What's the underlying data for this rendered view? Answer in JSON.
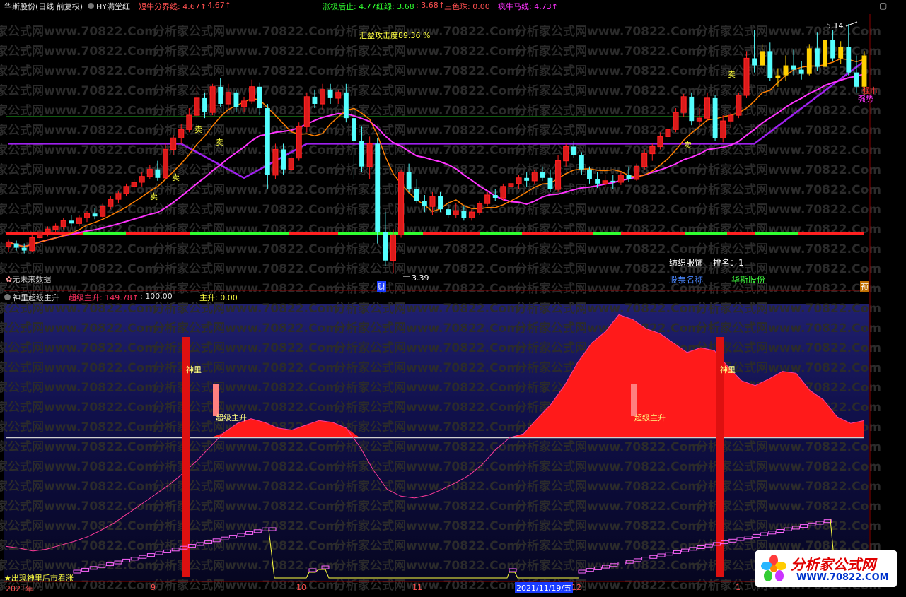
{
  "header": {
    "stock": "华斯股份",
    "period": "(日线 前复权)",
    "indicator": "HY满堂红",
    "bull_split": "短牛分界线: 4.67↑",
    "bull_split2": ": 4.67↑",
    "limit_stop": "涨极后止: 4.77",
    "red_green": "红绿: 3.68",
    "red_green2": ": 3.68↑",
    "three_color": "三色珠: 0.00",
    "crazy_bull": "疯牛马线: 4.73↑"
  },
  "annotations": {
    "attack": "汇盈攻击度89.36 %",
    "high": "5.14",
    "low": "3.39",
    "sell": "卖",
    "fin": "财",
    "pre": "预",
    "no_future": "无未来数据",
    "strong": "强市",
    "strong2": "强势"
  },
  "info_panel": {
    "industry": "纺织服饰",
    "rank": "排名：1",
    "name_label": "股票名称",
    "name_value": "华斯股份"
  },
  "sub_header": {
    "title": "神里超级主升",
    "super": "超级主升: 149.78↑",
    "fixed": ": 100.00",
    "main": "主升: 0.00"
  },
  "sub_annotations": {
    "shenli": "神里",
    "super_up": "超级主升",
    "hint": "★出现神里后市看涨"
  },
  "date_axis": {
    "year": "2021年",
    "m9": "9",
    "m10": "10",
    "m11": "11",
    "cursor": "2021/11/19/五",
    "m12": "12",
    "m1": "1"
  },
  "watermark": {
    "text1": "分析家公式网",
    "text2": "www.70822.Com",
    "logo_cn": "分析家公式网",
    "logo_en": "WWW.70822.COM"
  },
  "colors": {
    "up": "#ff2020",
    "down": "#54ffff",
    "ma_purple": "#a020f0",
    "ma_magenta": "#ff33ff",
    "ma_orange": "#ff7f00"
  },
  "chart_data": {
    "type": "candlestick",
    "ohlc": [
      [
        3.58,
        3.63,
        3.54,
        3.61
      ],
      [
        3.6,
        3.62,
        3.55,
        3.57
      ],
      [
        3.57,
        3.6,
        3.53,
        3.55
      ],
      [
        3.55,
        3.66,
        3.54,
        3.64
      ],
      [
        3.64,
        3.7,
        3.62,
        3.68
      ],
      [
        3.68,
        3.72,
        3.65,
        3.7
      ],
      [
        3.7,
        3.74,
        3.67,
        3.72
      ],
      [
        3.72,
        3.78,
        3.7,
        3.76
      ],
      [
        3.76,
        3.8,
        3.72,
        3.74
      ],
      [
        3.74,
        3.8,
        3.72,
        3.78
      ],
      [
        3.78,
        3.83,
        3.75,
        3.81
      ],
      [
        3.81,
        3.85,
        3.77,
        3.79
      ],
      [
        3.79,
        3.88,
        3.78,
        3.86
      ],
      [
        3.86,
        3.93,
        3.84,
        3.91
      ],
      [
        3.91,
        3.97,
        3.88,
        3.95
      ],
      [
        3.95,
        4.02,
        3.93,
        4.0
      ],
      [
        4.0,
        4.05,
        3.97,
        4.03
      ],
      [
        4.03,
        4.1,
        4.0,
        4.07
      ],
      [
        4.07,
        4.15,
        4.05,
        4.12
      ],
      [
        4.12,
        4.18,
        4.04,
        4.06
      ],
      [
        4.06,
        4.3,
        4.05,
        4.26
      ],
      [
        4.26,
        4.36,
        4.22,
        4.34
      ],
      [
        4.34,
        4.44,
        4.3,
        4.4
      ],
      [
        4.4,
        4.55,
        4.38,
        4.5
      ],
      [
        4.5,
        4.7,
        4.48,
        4.62
      ],
      [
        4.62,
        4.66,
        4.48,
        4.52
      ],
      [
        4.52,
        4.72,
        4.5,
        4.7
      ],
      [
        4.7,
        4.76,
        4.56,
        4.58
      ],
      [
        4.58,
        4.72,
        4.54,
        4.66
      ],
      [
        4.66,
        4.68,
        4.52,
        4.56
      ],
      [
        4.56,
        4.63,
        4.52,
        4.6
      ],
      [
        4.6,
        4.75,
        4.58,
        4.7
      ],
      [
        4.7,
        4.73,
        4.5,
        4.55
      ],
      [
        4.55,
        4.58,
        3.98,
        4.08
      ],
      [
        4.08,
        4.3,
        4.05,
        4.26
      ],
      [
        4.26,
        4.3,
        4.08,
        4.12
      ],
      [
        4.12,
        4.22,
        4.1,
        4.2
      ],
      [
        4.2,
        4.45,
        4.18,
        4.42
      ],
      [
        4.42,
        4.66,
        4.38,
        4.63
      ],
      [
        4.63,
        4.68,
        4.55,
        4.58
      ],
      [
        4.58,
        4.72,
        4.54,
        4.68
      ],
      [
        4.68,
        4.72,
        4.58,
        4.62
      ],
      [
        4.62,
        4.68,
        4.58,
        4.66
      ],
      [
        4.66,
        4.72,
        4.45,
        4.48
      ],
      [
        4.48,
        4.55,
        4.05,
        4.32
      ],
      [
        4.32,
        4.42,
        4.1,
        4.14
      ],
      [
        4.14,
        4.35,
        4.05,
        4.3
      ],
      [
        4.3,
        4.34,
        3.6,
        3.68
      ],
      [
        3.68,
        3.82,
        3.44,
        3.48
      ],
      [
        3.48,
        3.7,
        3.39,
        3.66
      ],
      [
        3.66,
        4.12,
        3.64,
        4.1
      ],
      [
        4.1,
        4.16,
        3.96,
        3.98
      ],
      [
        3.98,
        4.05,
        3.88,
        3.9
      ],
      [
        3.9,
        3.94,
        3.82,
        3.86
      ],
      [
        3.86,
        3.96,
        3.8,
        3.93
      ],
      [
        3.93,
        3.96,
        3.82,
        3.84
      ],
      [
        3.84,
        3.9,
        3.78,
        3.8
      ],
      [
        3.8,
        3.88,
        3.78,
        3.83
      ],
      [
        3.83,
        3.86,
        3.76,
        3.78
      ],
      [
        3.78,
        3.84,
        3.76,
        3.82
      ],
      [
        3.82,
        3.9,
        3.8,
        3.88
      ],
      [
        3.88,
        3.96,
        3.86,
        3.94
      ],
      [
        3.94,
        3.98,
        3.9,
        3.92
      ],
      [
        3.92,
        4.02,
        3.9,
        4.0
      ],
      [
        4.0,
        4.06,
        3.96,
        4.02
      ],
      [
        4.02,
        4.08,
        3.98,
        4.06
      ],
      [
        4.06,
        4.1,
        4.0,
        4.04
      ],
      [
        4.04,
        4.12,
        4.02,
        4.1
      ],
      [
        4.1,
        4.14,
        4.04,
        4.06
      ],
      [
        4.06,
        4.12,
        3.96,
        3.98
      ],
      [
        3.98,
        4.22,
        3.96,
        4.18
      ],
      [
        4.18,
        4.3,
        4.14,
        4.28
      ],
      [
        4.28,
        4.32,
        4.2,
        4.22
      ],
      [
        4.22,
        4.24,
        4.08,
        4.12
      ],
      [
        4.12,
        4.14,
        4.02,
        4.05
      ],
      [
        4.05,
        4.1,
        3.99,
        4.02
      ],
      [
        4.02,
        4.08,
        3.99,
        4.04
      ],
      [
        4.04,
        4.08,
        3.98,
        4.03
      ],
      [
        4.03,
        4.1,
        4.01,
        4.08
      ],
      [
        4.08,
        4.14,
        4.03,
        4.05
      ],
      [
        4.05,
        4.16,
        4.04,
        4.14
      ],
      [
        4.14,
        4.26,
        4.12,
        4.23
      ],
      [
        4.23,
        4.3,
        4.18,
        4.28
      ],
      [
        4.28,
        4.38,
        4.26,
        4.35
      ],
      [
        4.35,
        4.42,
        4.3,
        4.4
      ],
      [
        4.4,
        4.55,
        4.38,
        4.52
      ],
      [
        4.52,
        4.65,
        4.49,
        4.63
      ],
      [
        4.63,
        4.66,
        4.43,
        4.46
      ],
      [
        4.46,
        4.55,
        4.42,
        4.48
      ],
      [
        4.48,
        4.66,
        4.46,
        4.62
      ],
      [
        4.62,
        4.64,
        4.32,
        4.34
      ],
      [
        4.34,
        4.5,
        4.31,
        4.46
      ],
      [
        4.46,
        4.52,
        4.41,
        4.5
      ],
      [
        4.5,
        4.66,
        4.48,
        4.64
      ],
      [
        4.64,
        4.95,
        4.62,
        4.9
      ],
      [
        4.9,
        5.1,
        4.8,
        4.85
      ],
      [
        4.85,
        5.0,
        4.84,
        4.95
      ],
      [
        4.95,
        5.01,
        4.74,
        4.76
      ],
      [
        4.76,
        4.83,
        4.7,
        4.78
      ],
      [
        4.78,
        4.92,
        4.74,
        4.85
      ],
      [
        4.85,
        4.96,
        4.78,
        4.82
      ],
      [
        4.82,
        4.88,
        4.75,
        4.79
      ],
      [
        4.79,
        5.0,
        4.78,
        4.97
      ],
      [
        4.97,
        5.08,
        4.81,
        4.84
      ],
      [
        4.84,
        5.05,
        4.82,
        5.03
      ],
      [
        5.03,
        5.1,
        4.88,
        4.9
      ],
      [
        4.9,
        5.02,
        4.86,
        4.98
      ],
      [
        4.98,
        5.14,
        4.78,
        4.8
      ],
      [
        4.8,
        4.92,
        4.66,
        4.7
      ],
      [
        4.7,
        4.95,
        4.64,
        4.92
      ]
    ],
    "ma_purple_first": 4.3,
    "ma_purple_last": 4.88,
    "ma_magenta_first": 3.6,
    "ma_magenta_last": 4.87,
    "y_axis": {
      "min": 3.3,
      "max": 5.2
    },
    "sub_indicator": {
      "type": "area",
      "values": [
        35,
        33,
        30,
        32,
        36,
        40,
        45,
        52,
        60,
        70,
        80,
        90,
        100,
        112,
        125,
        140,
        155,
        165,
        170,
        166,
        160,
        158,
        163,
        168,
        166,
        160,
        140,
        115,
        95,
        88,
        86,
        89,
        95,
        102,
        110,
        122,
        138,
        150,
        154,
        170,
        185,
        205,
        230,
        250,
        262,
        280,
        275,
        265,
        260,
        250,
        240,
        245,
        242,
        225,
        210,
        205,
        212,
        220,
        218,
        200,
        190,
        172,
        165,
        168
      ],
      "threshold": 149.78,
      "level": 100
    }
  }
}
